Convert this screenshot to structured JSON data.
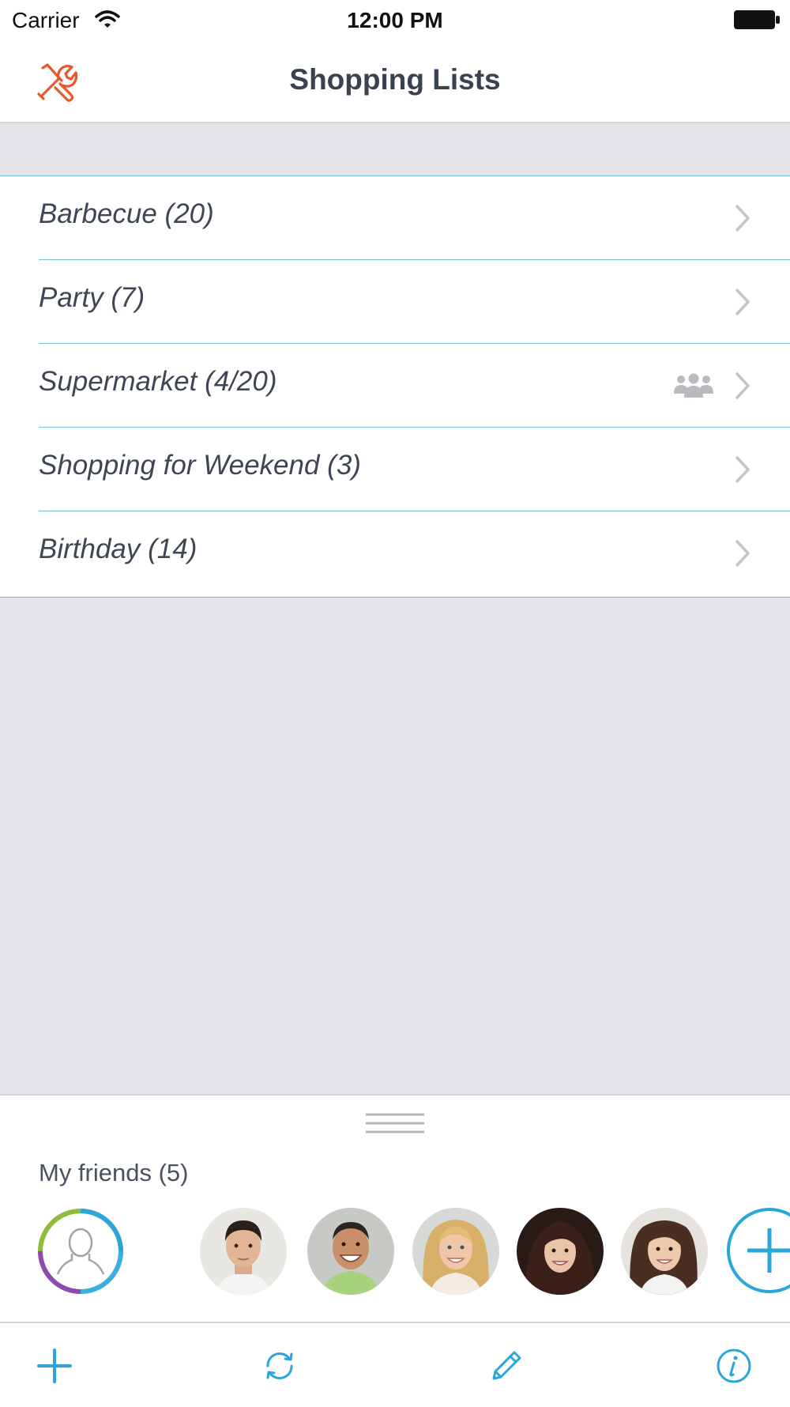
{
  "status_bar": {
    "carrier": "Carrier",
    "time": "12:00 PM"
  },
  "nav": {
    "title": "Shopping Lists",
    "settings_icon": "tools-icon"
  },
  "lists": [
    {
      "label": "Barbecue (20)",
      "shared": false
    },
    {
      "label": "Party (7)",
      "shared": false
    },
    {
      "label": "Supermarket (4/20)",
      "shared": true
    },
    {
      "label": "Shopping for Weekend (3)",
      "shared": false
    },
    {
      "label": "Birthday (14)",
      "shared": false
    }
  ],
  "friends": {
    "title": "My friends (5)",
    "avatars": [
      "my-profile-avatar",
      "friend-1-avatar",
      "friend-2-avatar",
      "friend-3-avatar",
      "friend-4-avatar",
      "friend-5-avatar"
    ]
  },
  "toolbar": {
    "items": [
      "plus-icon",
      "refresh-icon",
      "pencil-icon",
      "info-icon"
    ]
  },
  "colors": {
    "accent": "#2aa7d8",
    "settings_icon": "#e8582a",
    "separator": "#79c1e0",
    "background": "#e4e6ea",
    "text": "#3e4656"
  }
}
